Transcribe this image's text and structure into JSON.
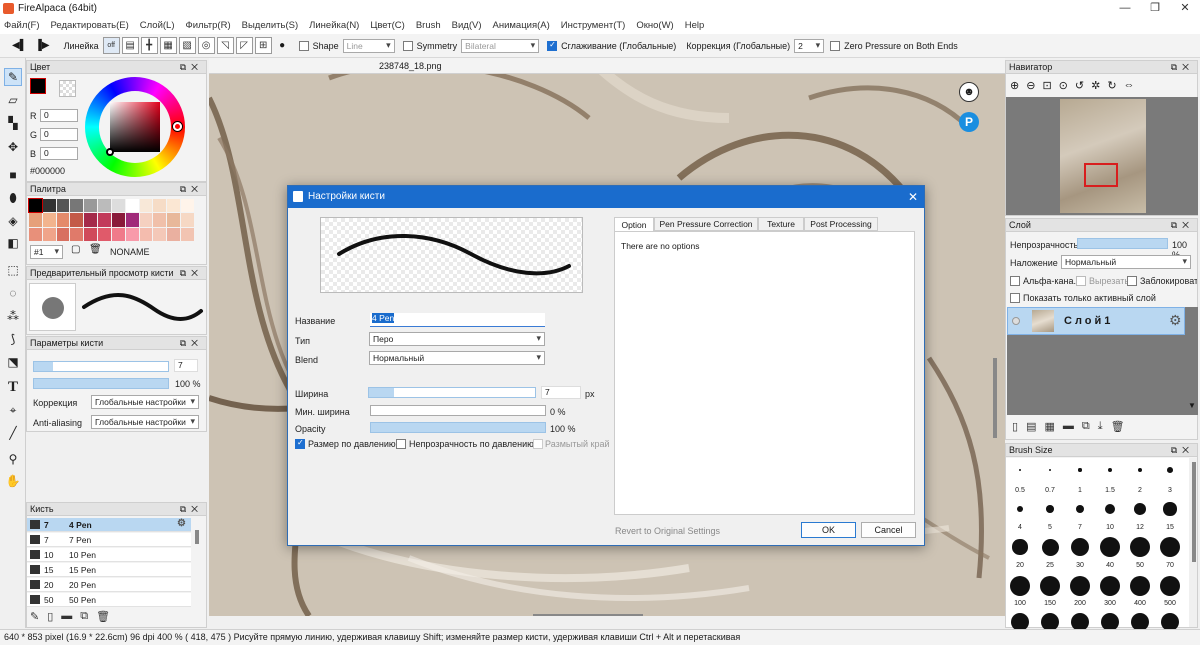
{
  "window": {
    "title": "FireAlpaca (64bit)"
  },
  "menu": [
    "Файл(F)",
    "Редактировать(E)",
    "Слой(L)",
    "Фильтр(R)",
    "Выделить(S)",
    "Линейка(N)",
    "Цвет(C)",
    "Brush",
    "Вид(V)",
    "Анимация(A)",
    "Инструмент(T)",
    "Окно(W)",
    "Help"
  ],
  "toolbar": {
    "ruler_label": "Линейка",
    "ruler_off": "off",
    "shape_label": "Shape",
    "shape_value": "Line",
    "symmetry_label": "Symmetry",
    "symmetry_value": "Bilateral",
    "smoothing_label": "Сглаживание (Глобальные)",
    "correction_label": "Коррекция (Глобальные)",
    "correction_value": "2",
    "zero_pressure_label": "Zero Pressure on Both Ends"
  },
  "color_panel": {
    "title": "Цвет",
    "r_label": "R",
    "r": "0",
    "g_label": "G",
    "g": "0",
    "b_label": "B",
    "b": "0",
    "hex": "#000000"
  },
  "palette_panel": {
    "title": "Палитра",
    "index": "#1",
    "name": "NONAME"
  },
  "brush_preview_panel": {
    "title": "Предварительный просмотр кисти"
  },
  "brush_params_panel": {
    "title": "Параметры кисти",
    "size": "7",
    "opacity": "100 %",
    "correction_label": "Коррекция",
    "correction_value": "Глобальные настройки",
    "aa_label": "Anti-aliasing",
    "aa_value": "Глобальные настройки"
  },
  "brush_panel": {
    "title": "Кисть",
    "items": [
      {
        "size": "7",
        "name": "4 Pen"
      },
      {
        "size": "7",
        "name": "7 Pen"
      },
      {
        "size": "10",
        "name": "10 Pen"
      },
      {
        "size": "15",
        "name": "15 Pen"
      },
      {
        "size": "20",
        "name": "20 Pen"
      },
      {
        "size": "50",
        "name": "50 Pen"
      }
    ]
  },
  "canvas": {
    "file_tab": "238748_18.png"
  },
  "navigator_panel": {
    "title": "Навигатор"
  },
  "layer_panel": {
    "title": "Слой",
    "opacity_label": "Непрозрачность",
    "opacity_value": "100 %",
    "blend_label": "Наложение",
    "blend_value": "Нормальный",
    "alpha_label": "Альфа-кана.",
    "clip_label": "Вырезать",
    "lock_label": "Заблокировать",
    "show_active_label": "Показать только активный слой",
    "layer_name": "Слой1"
  },
  "brush_size_panel": {
    "title": "Brush Size",
    "sizes": [
      "0.5",
      "0.7",
      "1",
      "1.5",
      "2",
      "3",
      "4",
      "5",
      "7",
      "10",
      "12",
      "15",
      "20",
      "25",
      "30",
      "40",
      "50",
      "70",
      "100",
      "150",
      "200",
      "300",
      "400",
      "500"
    ]
  },
  "dialog": {
    "title": "Настройки кисти",
    "name_label": "Название",
    "name_value": "4 Pen",
    "type_label": "Тип",
    "type_value": "Перо",
    "blend_label": "Blend",
    "blend_value": "Нормальный",
    "width_label": "Ширина",
    "width_value": "7",
    "width_unit": "px",
    "min_width_label": "Мин. ширина",
    "min_width_value": "0 %",
    "opacity_label": "Opacity",
    "opacity_value": "100 %",
    "size_pressure_label": "Размер по давлению",
    "opacity_pressure_label": "Непрозрачность по давлению",
    "blur_edge_label": "Размытый край",
    "tabs": [
      "Option",
      "Pen Pressure Correction",
      "Texture",
      "Post Processing"
    ],
    "no_options": "There are no options",
    "revert_label": "Revert to Original Settings",
    "ok_label": "OK",
    "cancel_label": "Cancel",
    "width_fraction": 0.15,
    "min_width_fraction": 0,
    "opacity_fraction": 1
  },
  "status": {
    "text": "640 * 853 pixel   (16.9 * 22.6cm)   96 dpi   400 %   ( 418, 475 )   Рисуйте прямую линию, удерживая клавишу Shift; изменяйте размер кисти, удерживая клавиши Ctrl + Alt и перетаскивая"
  },
  "colors": {
    "accent": "#1a6ccd",
    "selection": "#b9d7f1"
  }
}
